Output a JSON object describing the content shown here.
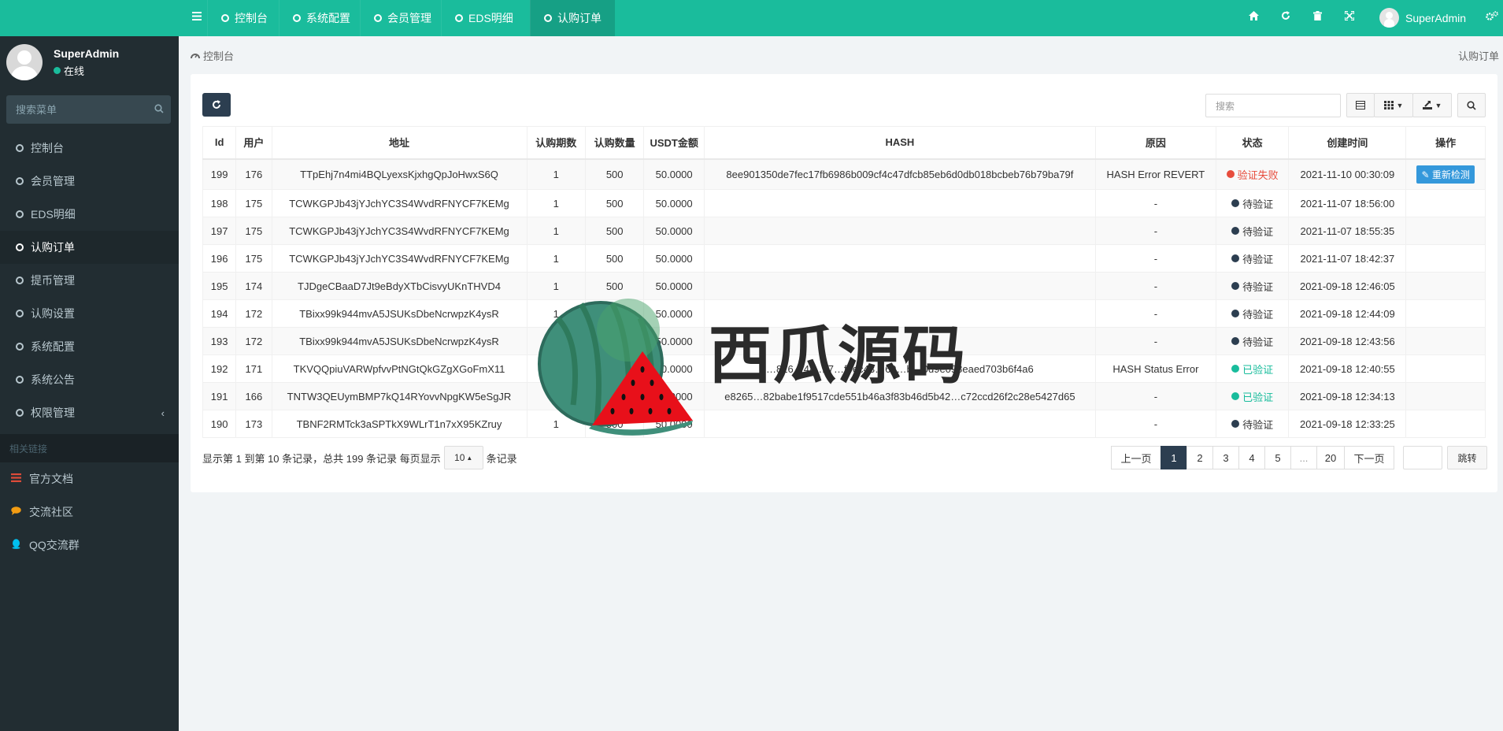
{
  "sidebar": {
    "user": {
      "name": "SuperAdmin",
      "status": "在线"
    },
    "search_placeholder": "搜索菜单",
    "items": [
      {
        "label": "控制台"
      },
      {
        "label": "会员管理"
      },
      {
        "label": "EDS明细"
      },
      {
        "label": "认购订单"
      },
      {
        "label": "提币管理"
      },
      {
        "label": "认购设置"
      },
      {
        "label": "系统配置"
      },
      {
        "label": "系统公告"
      },
      {
        "label": "权限管理"
      }
    ],
    "section_header": "相关链接",
    "links": [
      {
        "label": "官方文档",
        "icon": "list-icon",
        "color": "#dd4b39"
      },
      {
        "label": "交流社区",
        "icon": "comment-icon",
        "color": "#f39c12"
      },
      {
        "label": "QQ交流群",
        "icon": "qq-icon",
        "color": "#00c0ef"
      }
    ]
  },
  "navbar": {
    "tabs": [
      {
        "label": "控制台"
      },
      {
        "label": "系统配置"
      },
      {
        "label": "会员管理"
      },
      {
        "label": "EDS明细"
      },
      {
        "label": "认购订单"
      }
    ],
    "user_name": "SuperAdmin",
    "icons": [
      "home-icon",
      "refresh-icon",
      "trash-icon",
      "fullscreen-icon",
      "gears-icon"
    ],
    "accent": "#1abc9c"
  },
  "breadcrumb": {
    "left": "控制台",
    "right": "认购订单"
  },
  "toolbar": {
    "search_placeholder": "搜索"
  },
  "table": {
    "headers": [
      "Id",
      "用户",
      "地址",
      "认购期数",
      "认购数量",
      "USDT金额",
      "HASH",
      "原因",
      "状态",
      "创建时间",
      "操作"
    ],
    "rows": [
      {
        "id": "199",
        "user": "176",
        "addr": "TTpEhj7n4mi4BQLyexsKjxhgQpJoHwxS6Q",
        "period": "1",
        "qty": "500",
        "usdt": "50.0000",
        "hash": "8ee901350de7fec17fb6986b009cf4c47dfcb85eb6d0db018bcbeb76b79ba79f",
        "reason": "HASH Error REVERT",
        "status": "验证失败",
        "stype": "fail",
        "time": "2021-11-10 00:30:09",
        "action": "重新检测"
      },
      {
        "id": "198",
        "user": "175",
        "addr": "TCWKGPJb43jYJchYC3S4WvdRFNYCF7KEMg",
        "period": "1",
        "qty": "500",
        "usdt": "50.0000",
        "hash": "",
        "reason": "-",
        "status": "待验证",
        "stype": "wait",
        "time": "2021-11-07 18:56:00",
        "action": ""
      },
      {
        "id": "197",
        "user": "175",
        "addr": "TCWKGPJb43jYJchYC3S4WvdRFNYCF7KEMg",
        "period": "1",
        "qty": "500",
        "usdt": "50.0000",
        "hash": "",
        "reason": "-",
        "status": "待验证",
        "stype": "wait",
        "time": "2021-11-07 18:55:35",
        "action": ""
      },
      {
        "id": "196",
        "user": "175",
        "addr": "TCWKGPJb43jYJchYC3S4WvdRFNYCF7KEMg",
        "period": "1",
        "qty": "500",
        "usdt": "50.0000",
        "hash": "",
        "reason": "-",
        "status": "待验证",
        "stype": "wait",
        "time": "2021-11-07 18:42:37",
        "action": ""
      },
      {
        "id": "195",
        "user": "174",
        "addr": "TJDgeCBaaD7Jt9eBdyXTbCisvyUKnTHVD4",
        "period": "1",
        "qty": "500",
        "usdt": "50.0000",
        "hash": "",
        "reason": "-",
        "status": "待验证",
        "stype": "wait",
        "time": "2021-09-18 12:46:05",
        "action": ""
      },
      {
        "id": "194",
        "user": "172",
        "addr": "TBixx99k944mvA5JSUKsDbeNcrwpzK4ysR",
        "period": "1",
        "qty": "500",
        "usdt": "50.0000",
        "hash": "",
        "reason": "-",
        "status": "待验证",
        "stype": "wait",
        "time": "2021-09-18 12:44:09",
        "action": ""
      },
      {
        "id": "193",
        "user": "172",
        "addr": "TBixx99k944mvA5JSUKsDbeNcrwpzK4ysR",
        "period": "1",
        "qty": "500",
        "usdt": "50.0000",
        "hash": "",
        "reason": "-",
        "status": "待验证",
        "stype": "wait",
        "time": "2021-09-18 12:43:56",
        "action": ""
      },
      {
        "id": "192",
        "user": "171",
        "addr": "TKVQQpiuVARWpfvvPtNGtQkGZgXGoFmX11",
        "period": "1",
        "qty": "500",
        "usdt": "50.0000",
        "hash": "…816…48…f7…f9ec43…69…b…0d9e098eaed703b6f4a6",
        "reason": "HASH Status Error",
        "status": "已验证",
        "stype": "ok",
        "time": "2021-09-18 12:40:55",
        "action": ""
      },
      {
        "id": "191",
        "user": "166",
        "addr": "TNTW3QEUymBMP7kQ14RYovvNpgKW5eSgJR",
        "period": "1",
        "qty": "500",
        "usdt": "50.0000",
        "hash": "e8265…82babe1f9517cde551b46a3f83b46d5b42…c72ccd26f2c28e5427d65",
        "reason": "-",
        "status": "已验证",
        "stype": "ok",
        "time": "2021-09-18 12:34:13",
        "action": ""
      },
      {
        "id": "190",
        "user": "173",
        "addr": "TBNF2RMTck3aSPTkX9WLrT1n7xX95KZruy",
        "period": "1",
        "qty": "500",
        "usdt": "50.0000",
        "hash": "",
        "reason": "-",
        "status": "待验证",
        "stype": "wait",
        "time": "2021-09-18 12:33:25",
        "action": ""
      }
    ]
  },
  "pagination": {
    "info_prefix": "显示第 1 到第 10 条记录，总共 199 条记录 每页显示",
    "page_size": "10",
    "info_suffix": "条记录",
    "prev": "上一页",
    "pages": [
      "1",
      "2",
      "3",
      "4",
      "5",
      "...",
      "20"
    ],
    "next": "下一页",
    "jump": "跳转"
  },
  "watermark": {
    "text": "西瓜源码"
  }
}
